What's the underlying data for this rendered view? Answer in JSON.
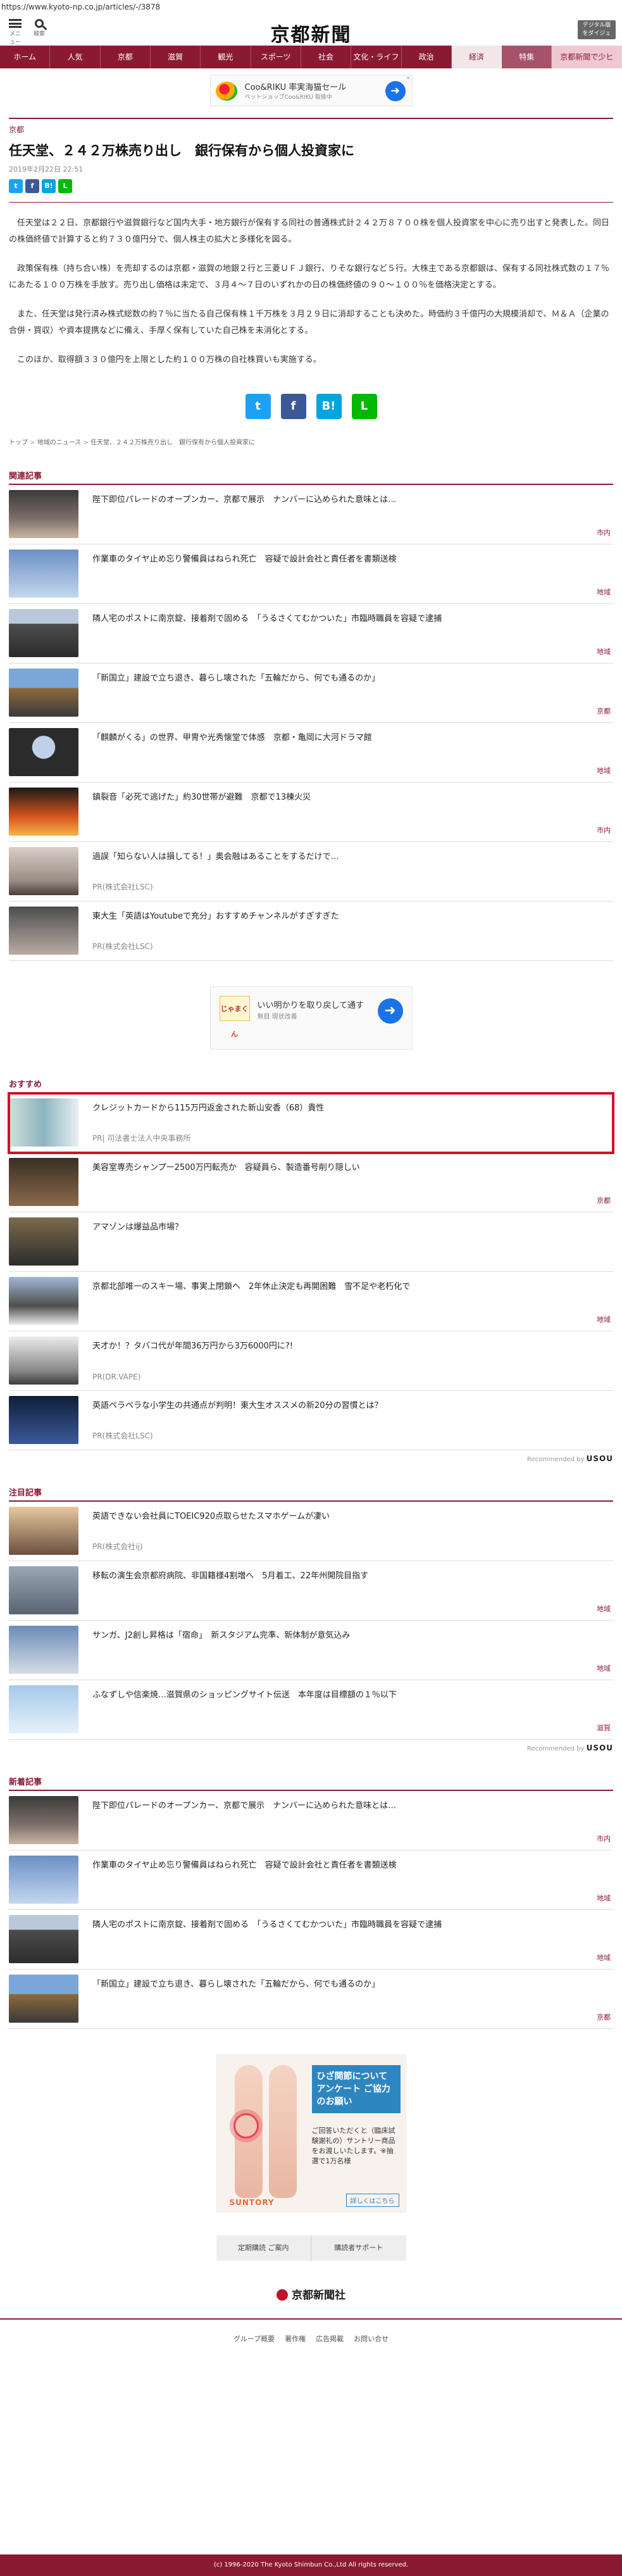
{
  "url": "https://www.kyoto-np.co.jp/articles/-/3878",
  "header": {
    "menu_label": "メニュー",
    "search_label": "検索",
    "logo": "京都新聞",
    "digital_label": "デジタル版\nをダイジェ"
  },
  "gnav": [
    "ホーム",
    "人気",
    "京都",
    "滋賀",
    "観光",
    "スポーツ",
    "社会",
    "文化・ライフ",
    "政治",
    "経済",
    "特集",
    "京都新聞で少ヒ"
  ],
  "ad_top": {
    "title": "Coo&RIKU 率実海猫セール",
    "sub": "ペットショップCoo&RIKU 取扱中",
    "close": "✕"
  },
  "article": {
    "category": "京都",
    "headline": "任天堂、２４２万株売り出し　銀行保有から個人投資家に",
    "date": "2019年2月22日 22:51",
    "paragraphs": [
      "任天堂は２２日、京都銀行や滋賀銀行など国内大手・地方銀行が保有する同社の普通株式計２４２万８７００株を個人投資家を中心に売り出すと発表した。同日の株価終値で計算すると約７３０億円分で、個人株主の拡大と多様化を図る。",
      "政策保有株（持ち合い株）を売却するのは京都・滋賀の地銀２行と三菱ＵＦＪ銀行、りそな銀行など５行。大株主である京都銀は、保有する同社株式数の１７％にあたる１００万株を手放す。売り出し価格は未定で、３月４～７日のいずれかの日の株価終値の９０～１００％を価格決定とする。",
      "また、任天堂は発行済み株式総数の約７％に当たる自己保有株１千万株を３月２９日に消却することも決めた。時価約３千億円の大規模消却で、Ｍ＆Ａ（企業の合併・買収）や資本提携などに備え、手厚く保有していた自己株を未消化とする。",
      "このほか、取得額３３０億円を上限とした約１００万株の自社株買いも実施する。"
    ]
  },
  "breadcrumb": [
    "トップ",
    "地域のニュース",
    "任天堂、２４２万株売り出し　銀行保有から個人投資家に"
  ],
  "related": {
    "title": "関連記事",
    "items": [
      {
        "text": "陛下即位パレードのオープンカー、京都で展示　ナンバーに込められた意味とは…",
        "tag": "市内",
        "pr": ""
      },
      {
        "text": "作業車のタイヤ止め忘り警備員はねられ死亡　容疑で設計会社と責任者を書類送検",
        "tag": "地域",
        "pr": ""
      },
      {
        "text": "隣人宅のポストに南京錠、接着剤で固める　「うるさくてむかついた」市臨時職員を容疑で逮捕",
        "tag": "地域",
        "pr": ""
      },
      {
        "text": "「新国立」建設で立ち退き、暮らし壊された「五輪だから、何でも通るのか」",
        "tag": "京都",
        "pr": ""
      },
      {
        "text": "「麒麟がくる」の世界、甲冑や光秀懐堂で体感　京都・亀岡に大河ドラマ館",
        "tag": "地域",
        "pr": ""
      },
      {
        "text": "鎮裂音「必死で逃げた」約30世帯が避難　京都で13棟火災",
        "tag": "市内",
        "pr": ""
      },
      {
        "text": "過誤「知らない人は損してる！」奥会融はあることをするだけで…",
        "tag": "",
        "pr": "PR(株式会社LSC)"
      },
      {
        "text": "東大生「英語はYoutubeで充分」おすすめチャンネルがすぎすぎた",
        "tag": "",
        "pr": "PR(株式会社LSC)"
      }
    ]
  },
  "ad_mid": {
    "logo": "じゃまくん",
    "title": "いい明かりを取り戻して通す",
    "sub": "無目 現状改善"
  },
  "recommend": {
    "title": "おすすめ",
    "items": [
      {
        "text": "クレジットカードから115万円返金された新山安香（68）貴性",
        "tag": "",
        "pr": "PR| 司法書士法人中央事務所"
      },
      {
        "text": "美容室専売シャンプー2500万円転売か　容疑員ら、製造番号削り隠しい",
        "tag": "京都",
        "pr": ""
      },
      {
        "text": "アマゾンは爆益品市場？",
        "tag": "",
        "pr": ""
      },
      {
        "text": "京都北部唯一のスキー場、事実上閉鎖へ　2年休止決定も再開困難　雪不足や老朽化で",
        "tag": "地域",
        "pr": ""
      },
      {
        "text": "天才か！？タバコ代が年間36万円から3万6000円に?!",
        "tag": "",
        "pr": "PR(DR.VAPE)"
      },
      {
        "text": "英語ペラペラな小学生の共通点が判明！東大生オススメの新20分の習慣とは？",
        "tag": "",
        "pr": "PR(株式会社LSC)"
      }
    ],
    "powered": "Recommended by",
    "brand": "USOU"
  },
  "featured": {
    "title": "注目記事",
    "items": [
      {
        "text": "英語できない会社員にTOEIC920点取らせたスマホゲームが凄い",
        "tag": "",
        "pr": "PR(株式会社ij)"
      },
      {
        "text": "移転の演生会京都府病院、非国籍様4割増へ　5月着工、22年州開院目指す",
        "tag": "地域",
        "pr": ""
      },
      {
        "text": "サンガ、J2創し昇格は「宿命」　新スタジアム完準、新体制が意気込み",
        "tag": "地域",
        "pr": ""
      },
      {
        "text": "ふなずしや信楽焼…滋賀県のショッピングサイト伝送　本年度は目標額の１％以下",
        "tag": "滋賀",
        "pr": ""
      }
    ],
    "powered": "Recommended by",
    "brand": "USOU"
  },
  "latest": {
    "title": "新着記事",
    "items": [
      {
        "text": "陛下即位パレードのオープンカー、京都で展示　ナンバーに込められた意味とは…",
        "tag": "市内"
      },
      {
        "text": "作業車のタイヤ止め忘り警備員はねられ死亡　容疑で設計会社と責任者を書類送検",
        "tag": "地域"
      },
      {
        "text": "隣人宅のポストに南京錠、接着剤で固める　「うるさくてむかついた」市臨時職員を容疑で逮捕",
        "tag": "地域"
      },
      {
        "text": "「新国立」建設で立ち退き、暮らし壊された「五輪だから、何でも通るのか」",
        "tag": "京都"
      }
    ]
  },
  "ad_big": {
    "headline": "ひざ関節について アンケート ご協力のお願い",
    "sub": "ご回答いただくと（臨床試験謝礼の）サントリー商品をお渡しいたします。※抽選で1万名様",
    "brand": "SUNTORY",
    "button": "詳しくはこちら"
  },
  "footer": {
    "links": [
      "定期購読 ご案内",
      "購読者サポート"
    ],
    "logo": "京都新聞社",
    "nav": [
      "グループ概要",
      "著作権",
      "広告掲載",
      "お問い合せ"
    ],
    "copyright": "(c) 1996-2020 The Kyoto Shimbun Co.,Ltd All rights reserved."
  },
  "colors": {
    "brand": "#8a1a32",
    "highlight": "#d2102a"
  }
}
